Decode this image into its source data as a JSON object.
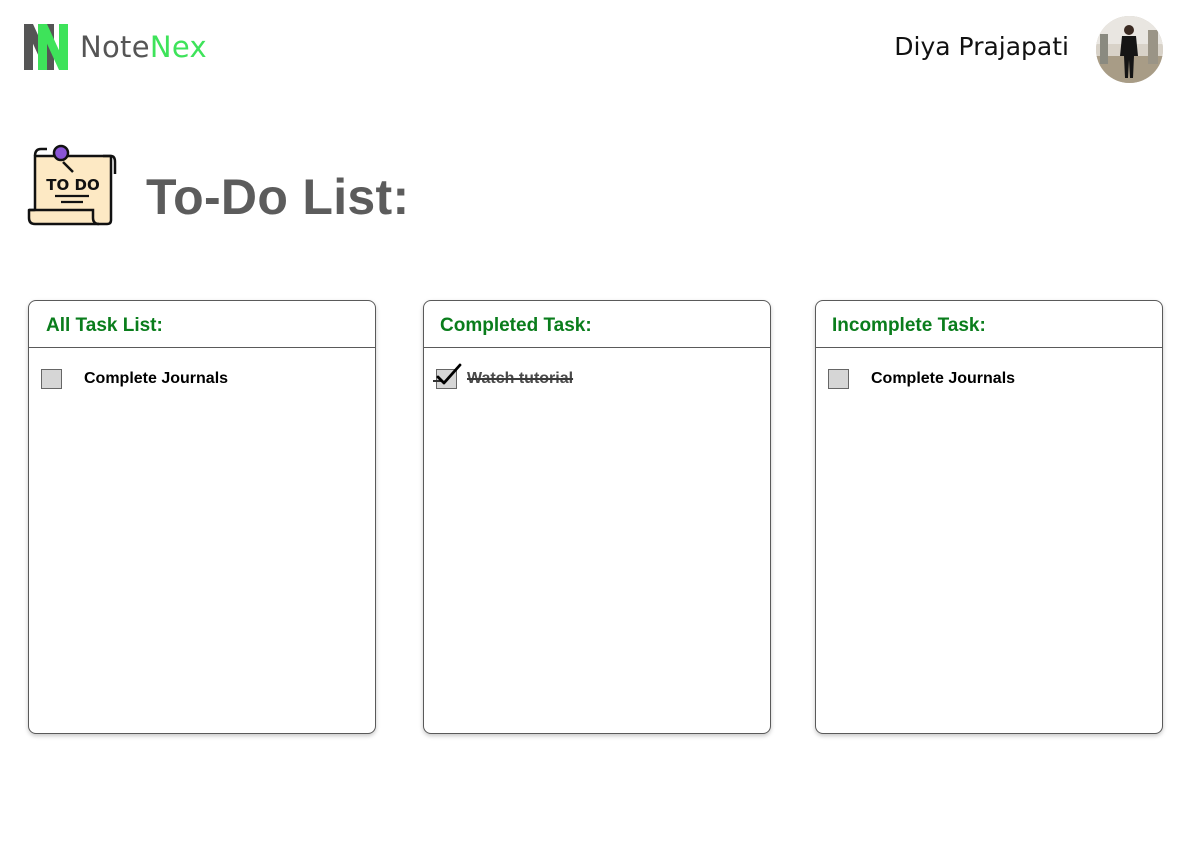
{
  "app": {
    "logo_note": "Note",
    "logo_nex": "Nex",
    "logo_icon": "notenex-logo-icon",
    "accent_green": "#3ee35a",
    "logo_gray": "#555555"
  },
  "user": {
    "name": "Diya Prajapati",
    "avatar_icon": "user-avatar"
  },
  "page": {
    "title": "To-Do List:",
    "title_icon": "todo-note-icon",
    "icon_text": "TO DO"
  },
  "columns": [
    {
      "header": "All Task List:",
      "tasks": [
        {
          "label": "Complete Journals",
          "checked": false
        }
      ]
    },
    {
      "header": "Completed Task:",
      "tasks": [
        {
          "label": "Watch tutorial",
          "checked": true
        }
      ]
    },
    {
      "header": "Incomplete Task:",
      "tasks": [
        {
          "label": "Complete Journals",
          "checked": false
        }
      ]
    }
  ],
  "colors": {
    "header_green": "#0a7d1c",
    "title_gray": "#5c5c5c",
    "checkbox_fill": "#d6d6d6"
  }
}
